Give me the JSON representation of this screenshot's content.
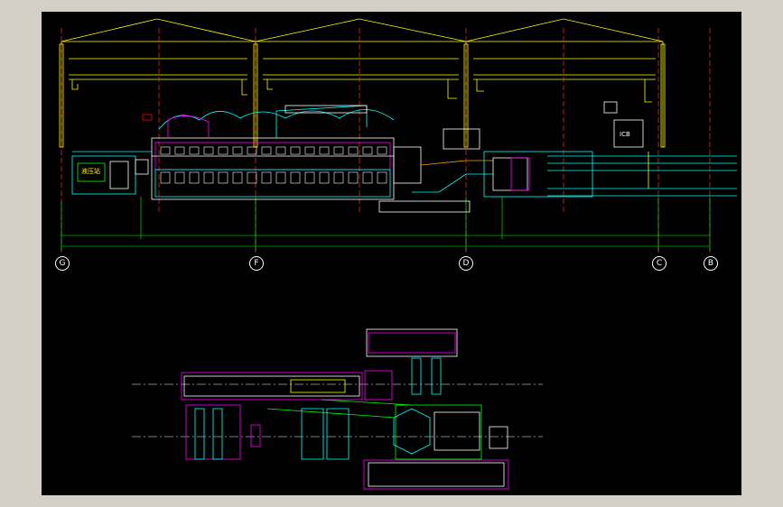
{
  "colors": {
    "window_bg": "#d4d0c8",
    "canvas_bg": "#000000",
    "building": "#ffff00",
    "grid_axis": "#ff3030",
    "dimension": "#00ff00",
    "equipment": "#ffffff",
    "cyan": "#00ffff",
    "magenta": "#ff00ff",
    "orange": "#ff9900"
  },
  "axes": {
    "G": "G",
    "F": "F",
    "D": "D",
    "C": "C",
    "B": "B"
  },
  "labels": {
    "room": "液压站",
    "cab": "ICB"
  }
}
